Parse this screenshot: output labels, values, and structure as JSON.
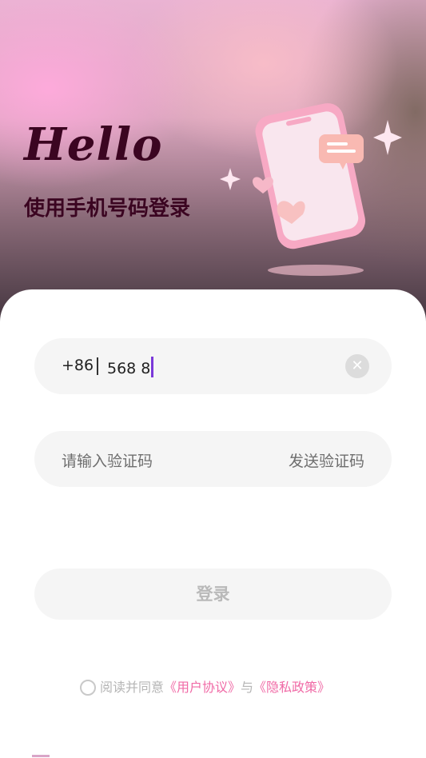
{
  "hero": {
    "title": "Hello",
    "subtitle": "使用手机号码登录",
    "illustration": "phone-with-hearts-illustration"
  },
  "phone_input": {
    "prefix": "+86",
    "value": "568 8",
    "clear_icon": "close-icon",
    "caret_color": "#7a39d9"
  },
  "code_input": {
    "placeholder": "请输入验证码",
    "send_label": "发送验证码"
  },
  "login": {
    "label": "登录"
  },
  "agreement": {
    "prefix": "阅读并同意",
    "user_agreement": "《用户协议》",
    "conjunction": "与",
    "privacy_policy": "《隐私政策》",
    "link_color": "#f06aa6"
  }
}
